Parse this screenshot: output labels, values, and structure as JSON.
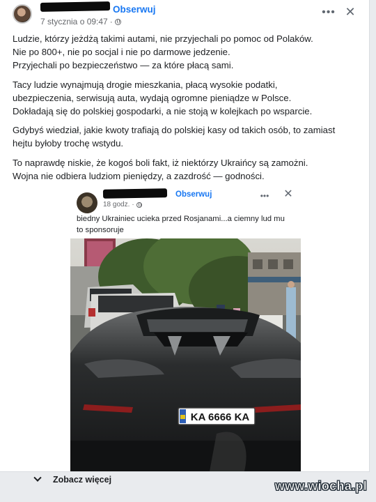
{
  "post": {
    "follow_label": "Obserwuj",
    "date": "7 stycznia o 09:47",
    "paragraphs": [
      [
        "Ludzie, którzy jeżdżą takimi autami, nie przyjechali po pomoc od Polaków.",
        "Nie po 800+, nie po socjal i nie po darmowe jedzenie.",
        "Przyjechali po bezpieczeństwo — za które płacą sami."
      ],
      [
        "Tacy ludzie wynajmują drogie mieszkania, płacą wysokie podatki,",
        "ubezpieczenia, serwisują auta, wydają ogromne pieniądze w Polsce.",
        "Dokładają się do polskiej gospodarki, a nie stoją w kolejkach po wsparcie."
      ],
      [
        "Gdybyś wiedział, jakie kwoty trafiają do polskiej kasy od takich osób, to zamiast",
        "hejtu byłoby trochę wstydu."
      ],
      [
        "To naprawdę niskie, że kogoś boli fakt, iż niektórzy Ukraińcy są zamożni.",
        "Wojna nie odbiera ludziom pieniędzy, a zazdrość — godności."
      ]
    ]
  },
  "shared_post": {
    "follow_label": "Obserwuj",
    "time": "18 godz.",
    "text_lines": [
      "biedny Ukrainiec ucieka przed Rosjanami...a ciemny lud mu",
      "to sponsoruje"
    ],
    "plate": "KA 6666 KA"
  },
  "footer": {
    "see_more": "Zobacz więcej"
  },
  "watermark": "www.wiocha.pl",
  "icons": [
    "more-options-icon",
    "close-icon",
    "globe-icon",
    "chevron-down-icon"
  ]
}
